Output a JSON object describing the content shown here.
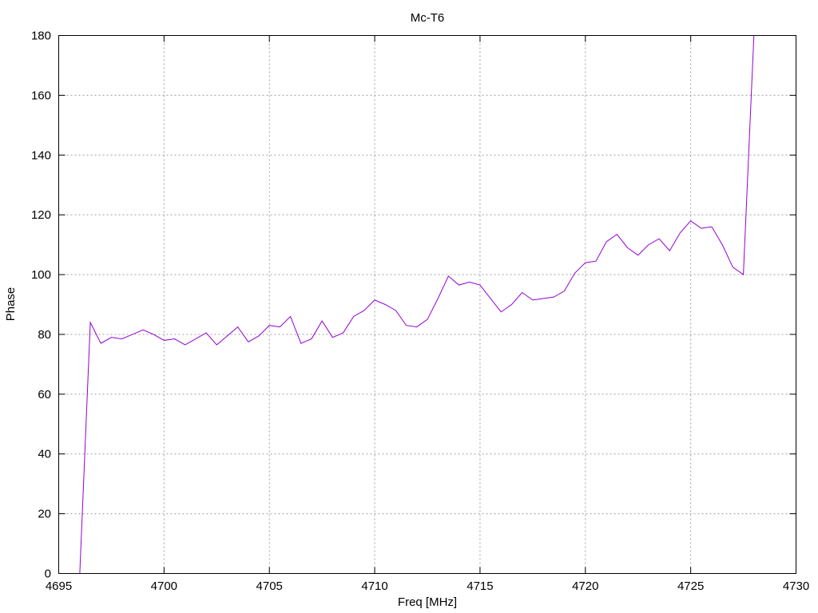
{
  "chart_data": {
    "type": "line",
    "title": "Mc-T6",
    "xlabel": "Freq [MHz]",
    "ylabel": "Phase",
    "xlim": [
      4695,
      4730
    ],
    "ylim": [
      0,
      180
    ],
    "xticks": [
      "4695",
      "4700",
      "4705",
      "4710",
      "4715",
      "4720",
      "4725",
      "4730"
    ],
    "yticks": [
      "0",
      "20",
      "40",
      "60",
      "80",
      "100",
      "120",
      "140",
      "160",
      "180"
    ],
    "grid": true,
    "line_color": "#9400d3",
    "series": [
      {
        "x": [
          4696.0,
          4696.5,
          4697.0,
          4697.5,
          4698.0,
          4698.5,
          4699.0,
          4699.5,
          4700.0,
          4700.5,
          4701.0,
          4701.5,
          4702.0,
          4702.5,
          4703.0,
          4703.5,
          4704.0,
          4704.5,
          4705.0,
          4705.5,
          4706.0,
          4706.5,
          4707.0,
          4707.5,
          4708.0,
          4708.5,
          4709.0,
          4709.5,
          4710.0,
          4710.5,
          4711.0,
          4711.5,
          4712.0,
          4712.5,
          4713.0,
          4713.5,
          4714.0,
          4714.5,
          4715.0,
          4715.5,
          4716.0,
          4716.5,
          4717.0,
          4717.5,
          4718.0,
          4718.5,
          4719.0,
          4719.5,
          4720.0,
          4720.5,
          4721.0,
          4721.5,
          4722.0,
          4722.5,
          4723.0,
          4723.5,
          4724.0,
          4724.5,
          4725.0,
          4725.5,
          4726.0,
          4726.5,
          4727.0,
          4727.5,
          4728.0
        ],
        "y": [
          0,
          84,
          77,
          79,
          78.5,
          80,
          81.5,
          80,
          78,
          78.5,
          76.5,
          78.5,
          80.5,
          76.5,
          79.5,
          82.5,
          77.5,
          79.5,
          83,
          82.5,
          86,
          77,
          78.5,
          84.5,
          79,
          80.5,
          86,
          88,
          91.5,
          90,
          88,
          83,
          82.5,
          85,
          92,
          99.5,
          96.5,
          97.5,
          96.5,
          92,
          87.5,
          90,
          94,
          91.5,
          92,
          92.5,
          94.5,
          100.5,
          104,
          104.5,
          111,
          113.5,
          109,
          106.5,
          110,
          112,
          108,
          114,
          118,
          115.5,
          116,
          110,
          102.5,
          100,
          180
        ]
      }
    ]
  }
}
